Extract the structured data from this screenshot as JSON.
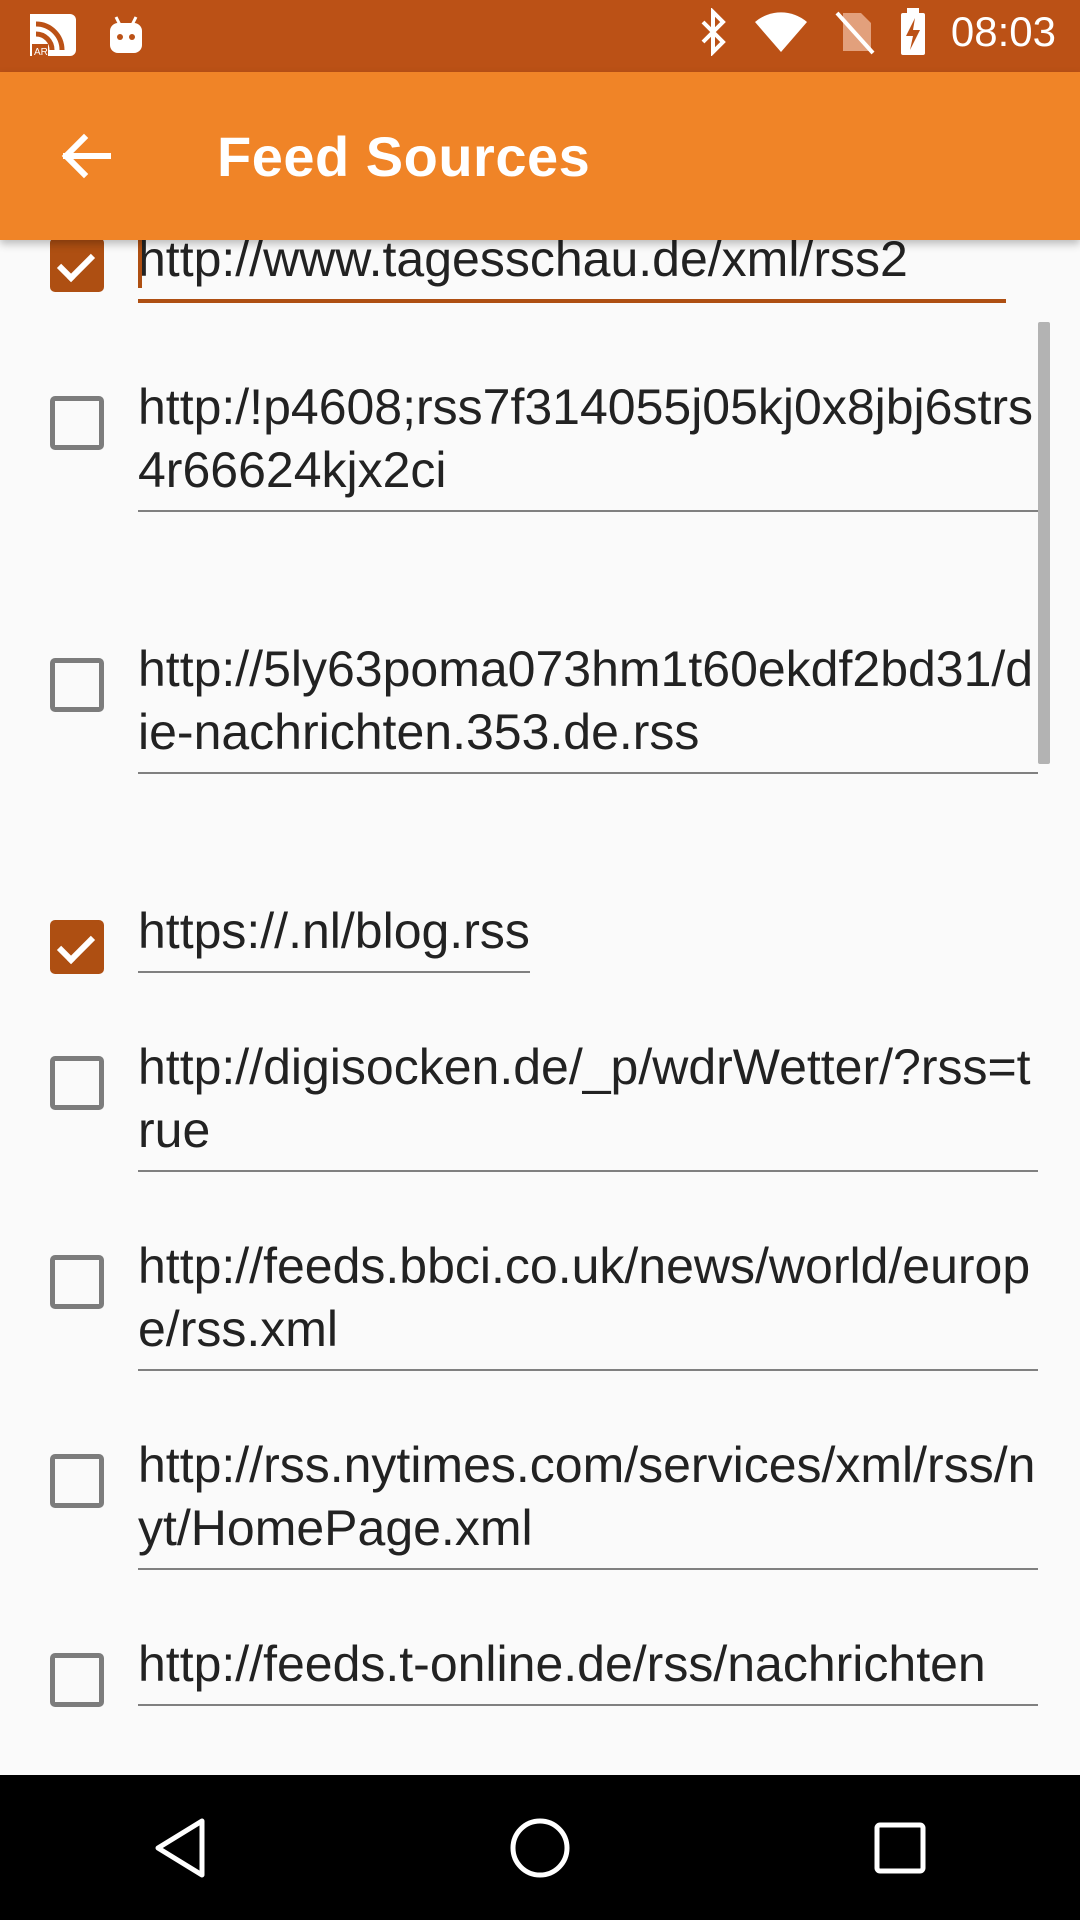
{
  "status_bar": {
    "time": "08:03",
    "left_icons": [
      "rss-reader-app-icon",
      "android-debug-icon"
    ],
    "right_icons": [
      "bluetooth-icon",
      "wifi-icon",
      "no-sim-icon",
      "battery-charging-icon"
    ]
  },
  "app_bar": {
    "title": "Feed Sources",
    "back_icon": "arrow-left-icon"
  },
  "feeds": [
    {
      "url": "http://www.tagesschau.de/xml/rss2",
      "checked": true,
      "focused": true
    },
    {
      "url": "http:/!p4608;rss7f314055j05kj0x8jbj6strs4r66624kjx2ci",
      "checked": false
    },
    {
      "url": "http://5ly63poma073hm1t60ekdf2bd31/die-nachrichten.353.de.rss",
      "checked": false
    },
    {
      "url": "https://.nl/blog.rss",
      "checked": true
    },
    {
      "url": "http://digisocken.de/_p/wdrWetter/?rss=true",
      "checked": false
    },
    {
      "url": "http://feeds.bbci.co.uk/news/world/europe/rss.xml",
      "checked": false
    },
    {
      "url": "http://rss.nytimes.com/services/xml/rss/nyt/HomePage.xml",
      "checked": false
    },
    {
      "url": "http://feeds.t-online.de/rss/nachrichten",
      "checked": false
    }
  ],
  "colors": {
    "status_bar": "#bb5116",
    "app_bar": "#f08427",
    "accent": "#ae4f12"
  },
  "nav_bar": {
    "buttons": [
      "back-triangle-icon",
      "home-circle-icon",
      "recents-square-icon"
    ]
  }
}
